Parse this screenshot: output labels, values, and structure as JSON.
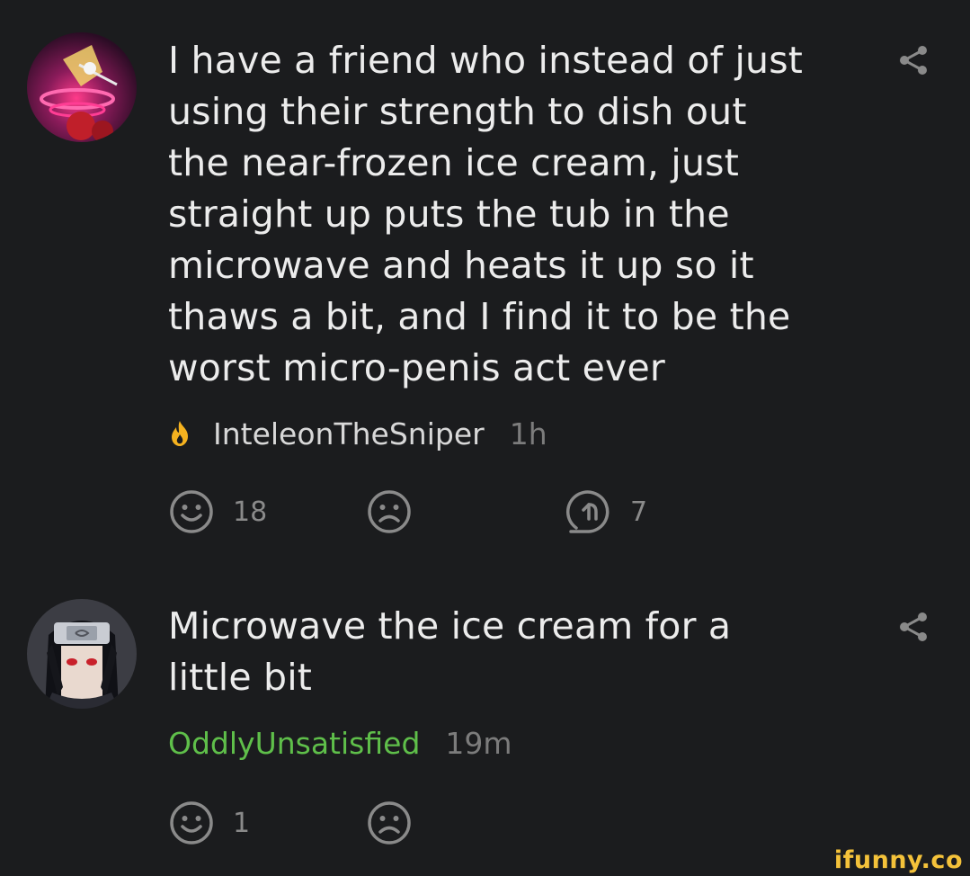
{
  "comments": [
    {
      "text": "I have a friend who instead of just\nusing their strength to dish out\nthe near-frozen ice cream, just\nstraight up puts the tub in the\nmicrowave and heats it up so it\nthaws a bit, and I find it to be the\nworst micro-penis act ever",
      "username": "InteleonTheSniper",
      "time": "1h",
      "smile_count": "18",
      "reply_count": "7",
      "badge_icon": "flame-icon",
      "username_color": "#d8d8d8"
    },
    {
      "text": "Microwave the ice cream for a\nlittle bit",
      "username": "OddlyUnsatisfied",
      "time": "19m",
      "smile_count": "1",
      "username_color": "#5fbf4a"
    }
  ],
  "watermark": "ifunny.co",
  "colors": {
    "background": "#1b1c1e",
    "text": "#ececec",
    "muted": "#7c7c7c",
    "icon": "#8a8a8a",
    "accent_green": "#5fbf4a",
    "flame": "#f5b21f"
  }
}
